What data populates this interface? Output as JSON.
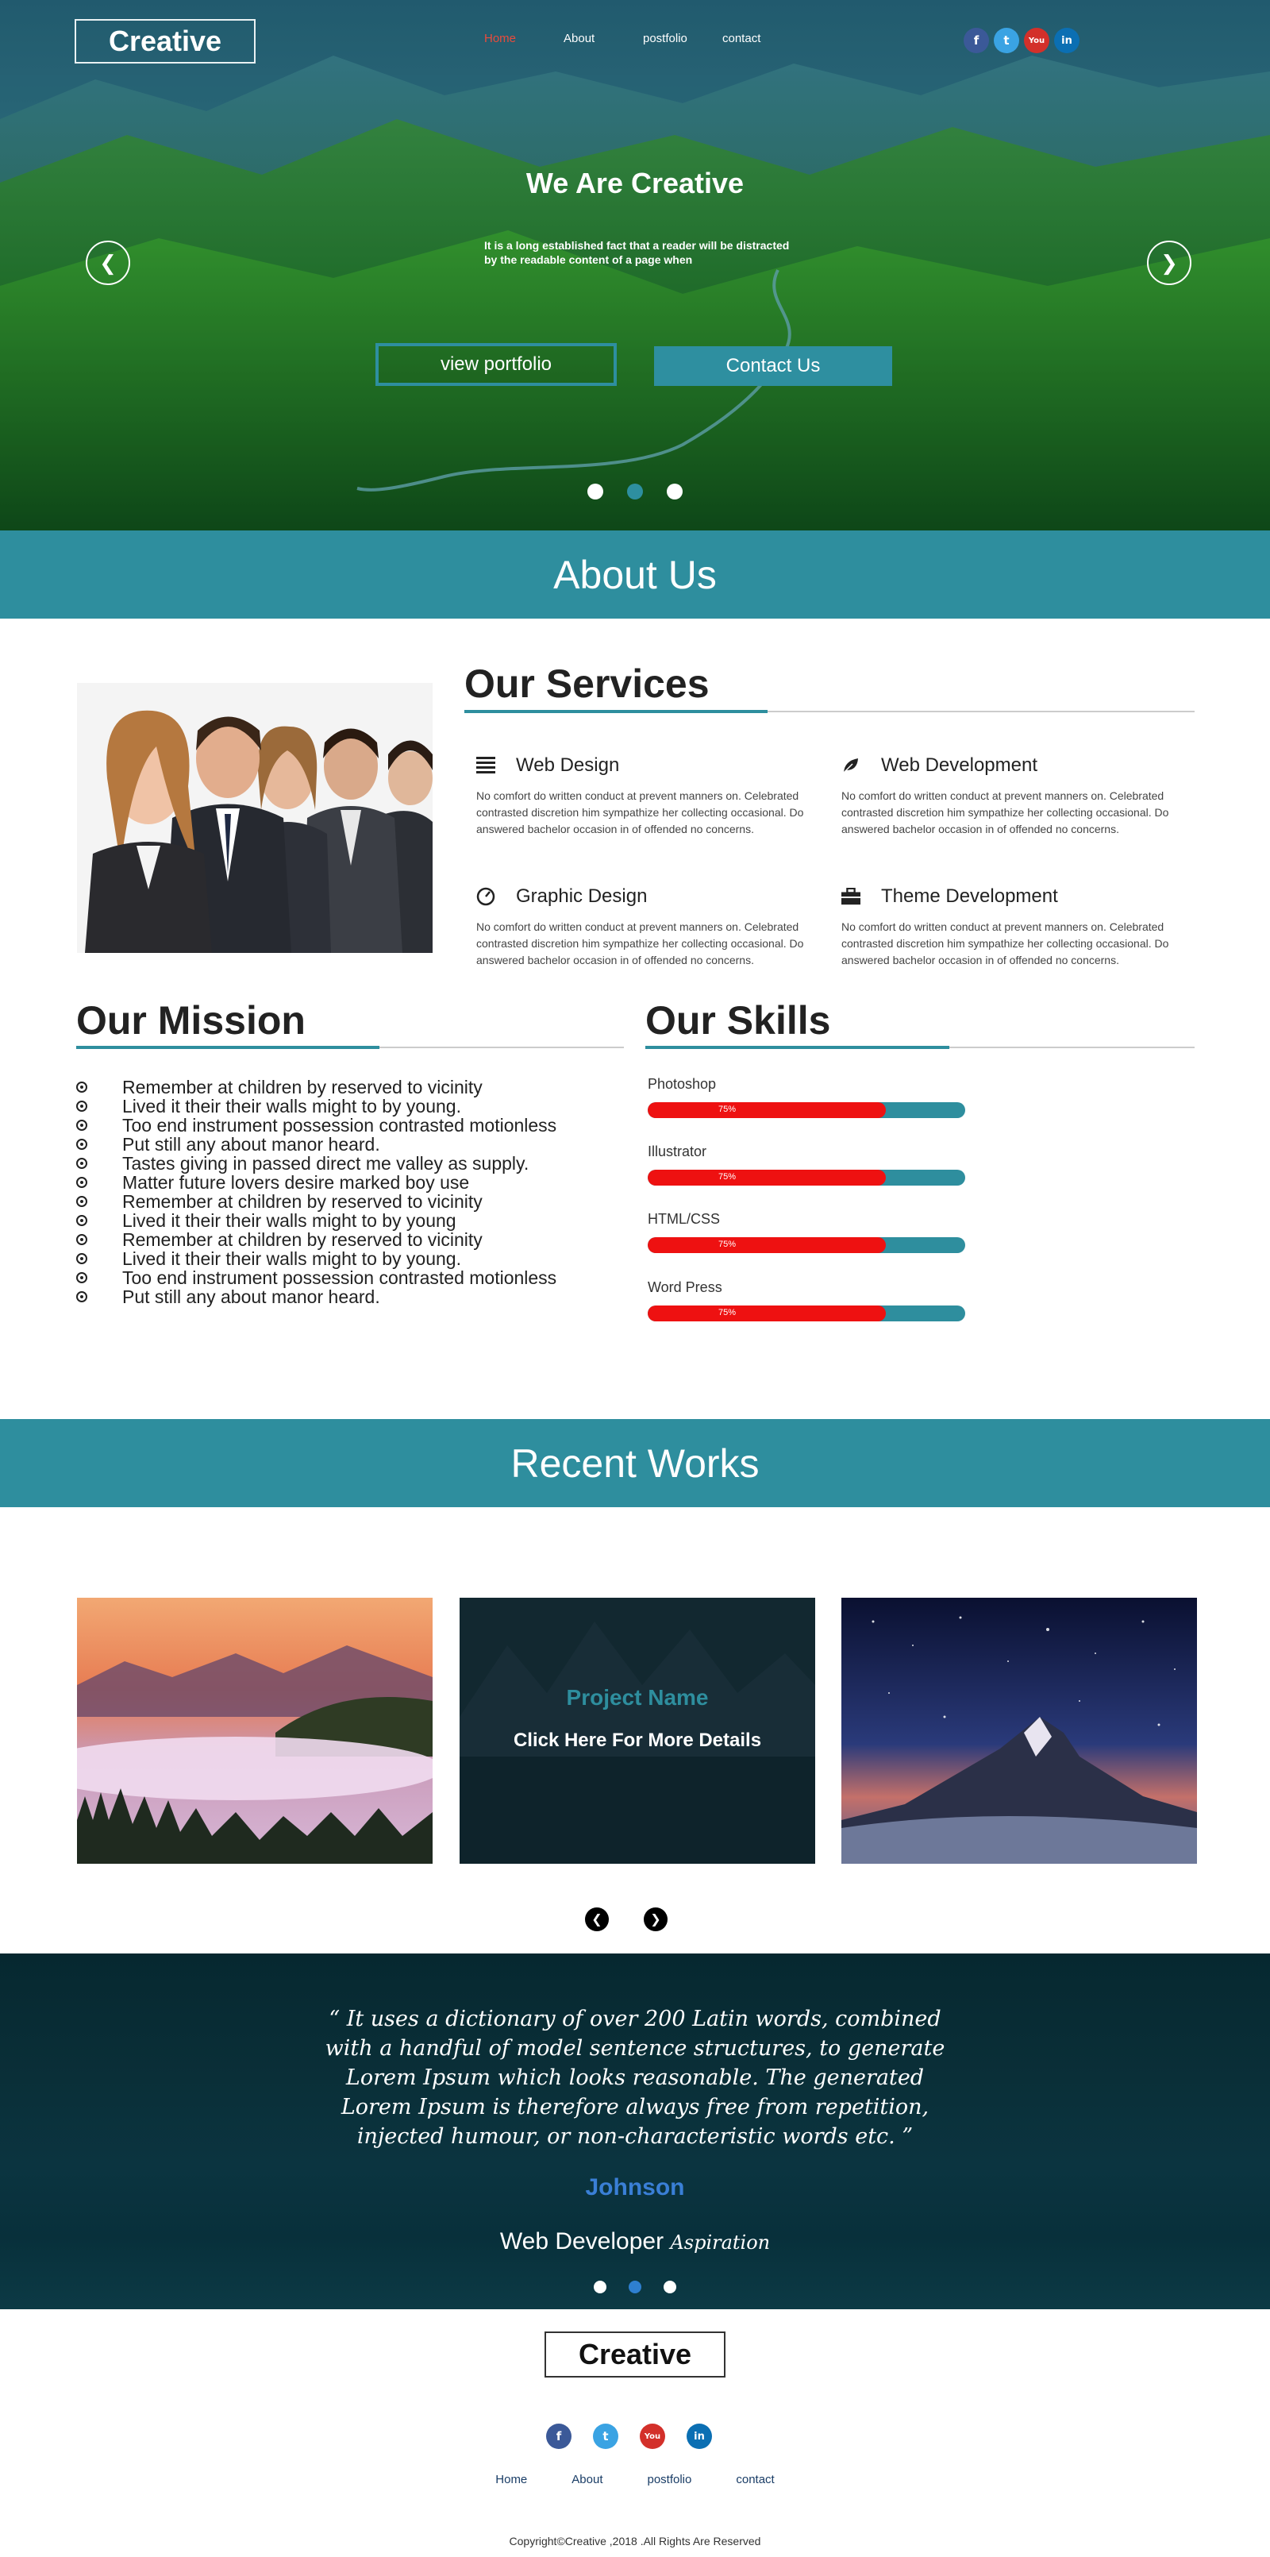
{
  "brand": {
    "logo": "Creative"
  },
  "nav": {
    "items": [
      {
        "label": "Home",
        "active": true
      },
      {
        "label": "About"
      },
      {
        "label": "postfolio"
      },
      {
        "label": "contact"
      }
    ]
  },
  "social": [
    {
      "icon": "facebook-icon",
      "glyph": "f",
      "color": "#3b5998"
    },
    {
      "icon": "twitter-icon",
      "glyph": "t",
      "color": "#3aa3e3"
    },
    {
      "icon": "youtube-icon",
      "glyph": "You",
      "color": "#d3302a"
    },
    {
      "icon": "linkedin-icon",
      "glyph": "in",
      "color": "#0b6fb3"
    }
  ],
  "hero": {
    "title": "We Are Creative",
    "subtitle": "It is a long established fact that a reader will be distracted by the readable content of a page when",
    "btn_portfolio": "view portfolio",
    "btn_contact": "Contact Us",
    "prev_icon": "chevron-left-icon",
    "next_icon": "chevron-right-icon",
    "active_slide": 2
  },
  "about": {
    "band_title": "About Us"
  },
  "services": {
    "title": "Our Services",
    "items": [
      {
        "title": "Web Design",
        "icon": "list-icon",
        "desc": "No comfort do written conduct at prevent manners on. Celebrated contrasted discretion him sympathize her collecting occasional. Do answered bachelor occasion in of offended no concerns."
      },
      {
        "title": "Web Development",
        "icon": "leaf-icon",
        "desc": "No comfort do written conduct at prevent manners on. Celebrated contrasted discretion him sympathize her collecting occasional. Do answered bachelor occasion in of offended no concerns."
      },
      {
        "title": "Graphic Design",
        "icon": "dashboard-icon",
        "desc": "No comfort do written conduct at prevent manners on. Celebrated contrasted discretion him sympathize her collecting occasional. Do answered bachelor occasion in of offended no concerns."
      },
      {
        "title": "Theme Development",
        "icon": "briefcase-icon",
        "desc": "No comfort do written conduct at prevent manners on. Celebrated contrasted discretion him sympathize her collecting occasional. Do answered bachelor occasion in of offended no concerns."
      }
    ]
  },
  "mission": {
    "title": "Our Mission",
    "items": [
      "Remember at children by reserved to vicinity",
      "Lived it their their walls might to by young.",
      "Too end instrument possession contrasted motionless",
      "Put still any about manor heard.",
      "Tastes giving in passed direct me valley as supply.",
      "Matter future lovers desire marked boy use",
      "Remember at children by reserved to vicinity",
      "Lived it their their walls might to by young",
      "Remember at children by reserved to vicinity",
      "Lived it their their walls might to by young.",
      "Too end instrument possession contrasted motionless",
      "Put still any about manor heard."
    ]
  },
  "skills": {
    "title": "Our Skills",
    "items": [
      {
        "name": "Photoshop",
        "percent": 75,
        "label": "75%"
      },
      {
        "name": "Illustrator",
        "percent": 75,
        "label": "75%"
      },
      {
        "name": "HTML/CSS",
        "percent": 75,
        "label": "75%"
      },
      {
        "name": "Word Press",
        "percent": 75,
        "label": "75%"
      }
    ]
  },
  "works": {
    "band_title": "Recent Works",
    "project_name": "Project Name",
    "project_link": "Click Here For More Details",
    "prev_icon": "chevron-left-icon",
    "next_icon": "chevron-right-icon"
  },
  "testimonial": {
    "quote": "“ It uses a dictionary of over 200 Latin words, combined with a handful of model sentence structures, to generate Lorem Ipsum which looks reasonable. The generated Lorem Ipsum is therefore always free from repetition, injected humour, or non-characteristic words etc. ”",
    "author": "Johnson",
    "role": "Web Developer",
    "role_script": "Aspiration",
    "active_slide": 2
  },
  "footer": {
    "logo": "Creative",
    "nav": [
      "Home",
      "About",
      "postfolio",
      "contact"
    ],
    "copyright": "Copyright©Creative ,2018 .All Rights Are Reserved"
  },
  "colors": {
    "accent": "#2e8e9e",
    "nav_active": "#e94b3c",
    "skill_fill": "#ee1111",
    "author": "#3a7fd6"
  }
}
